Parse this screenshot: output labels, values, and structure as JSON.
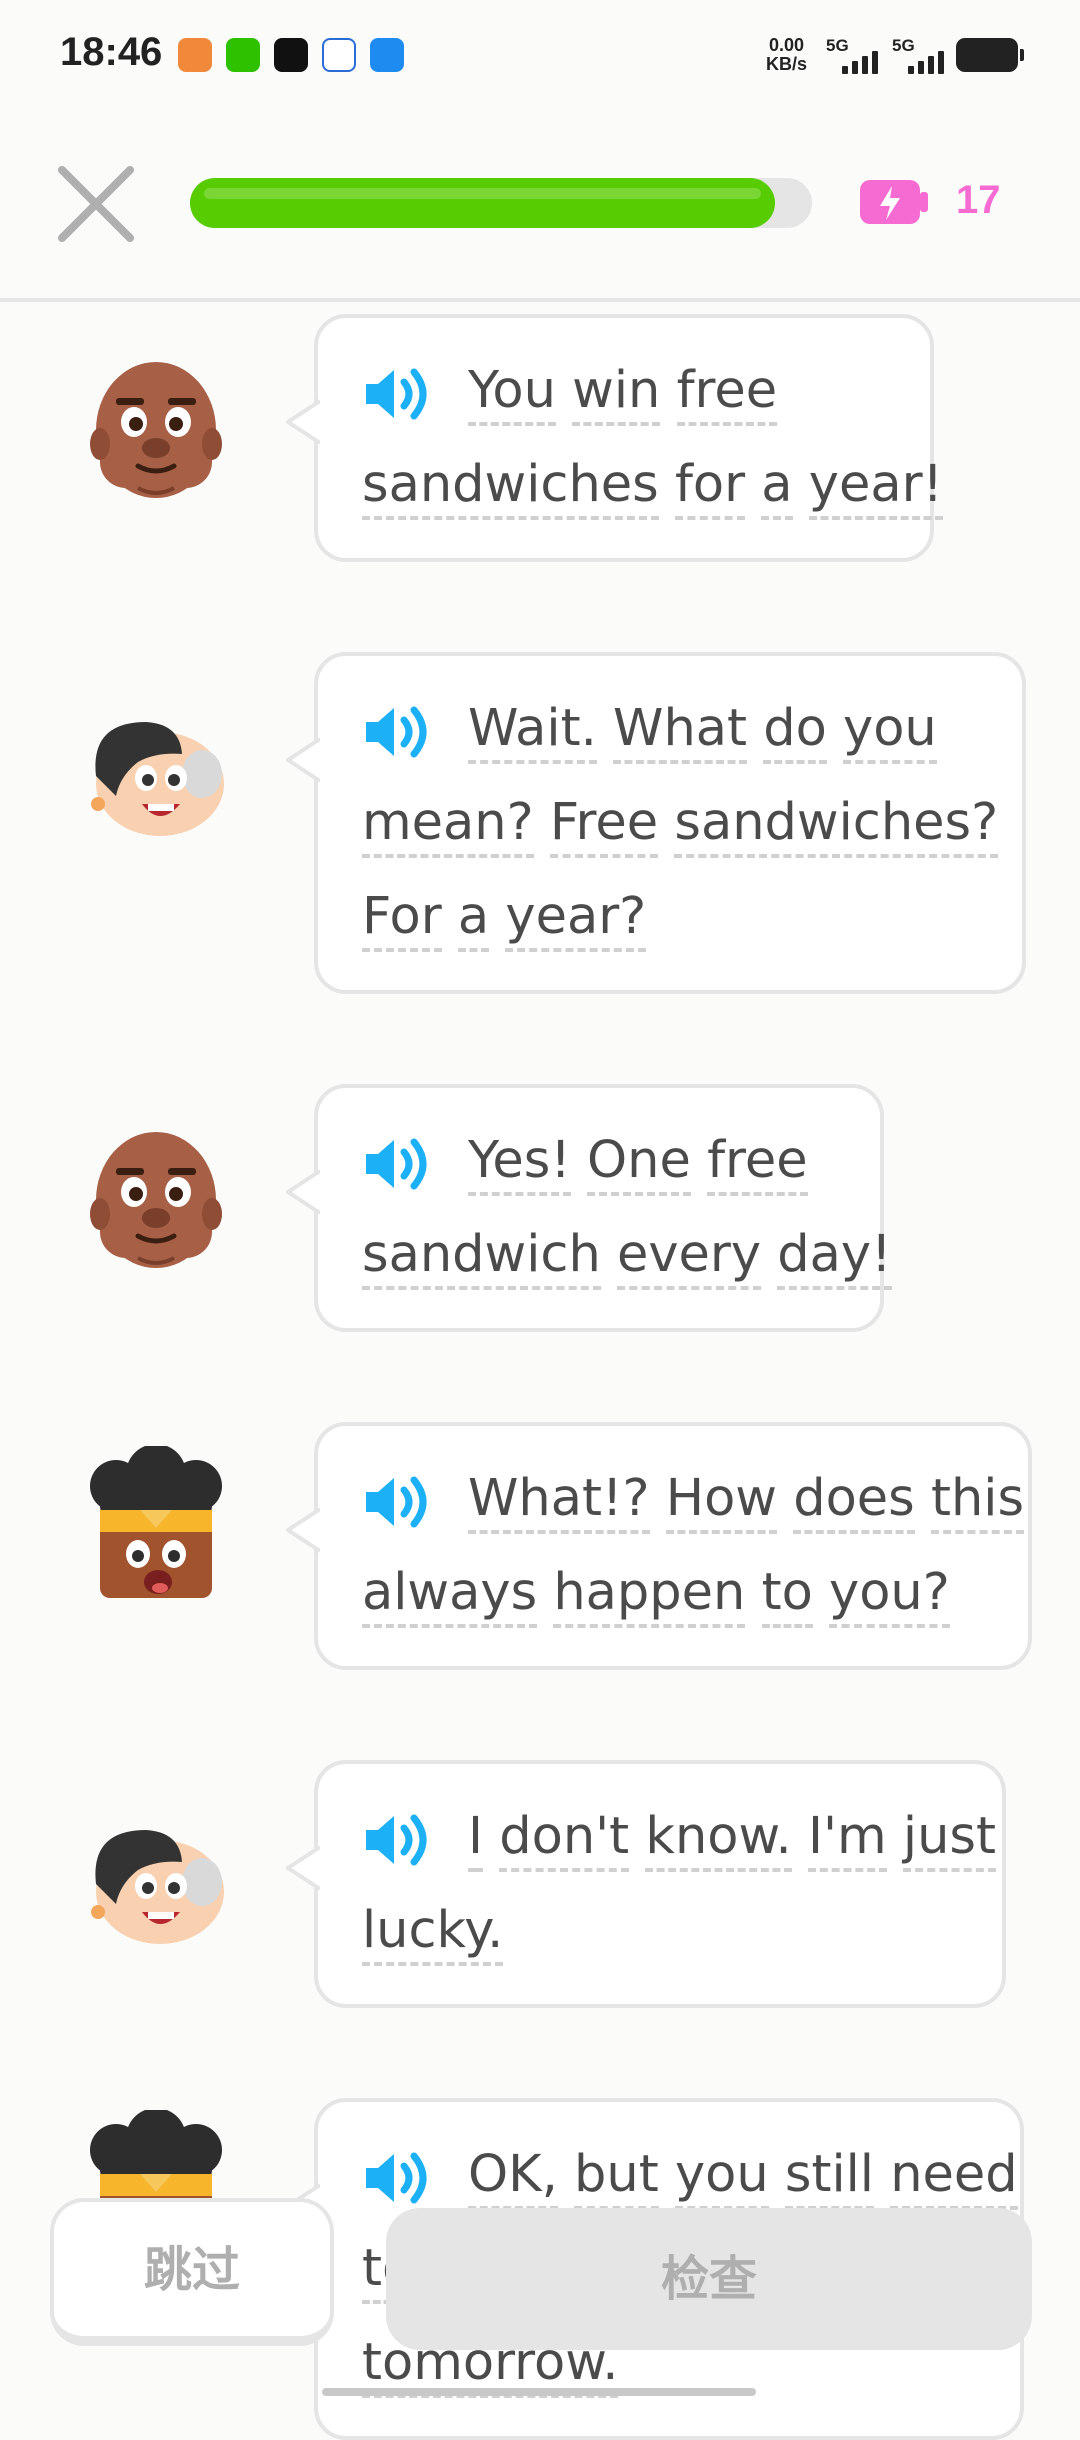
{
  "status_bar": {
    "time": "18:46",
    "net_speed_value": "0.00",
    "net_speed_unit": "KB/s",
    "sim1_label": "5G",
    "sim2_label": "5G"
  },
  "header": {
    "progress_fraction": 0.94,
    "energy_count": "17",
    "accent_green": "#58cc02",
    "energy_color": "#f56bd1"
  },
  "dialogue": [
    {
      "speaker": "eddy",
      "lines": [
        [
          "You",
          "win",
          "free"
        ],
        [
          "sandwiches",
          "for",
          "a",
          "year!"
        ]
      ]
    },
    {
      "speaker": "lin",
      "lines": [
        [
          "Wait.",
          "What",
          "do",
          "you"
        ],
        [
          "mean?",
          "Free",
          "sandwiches?"
        ],
        [
          "For",
          "a",
          "year?"
        ]
      ]
    },
    {
      "speaker": "eddy",
      "lines": [
        [
          "Yes!",
          "One",
          "free"
        ],
        [
          "sandwich",
          "every",
          "day!"
        ]
      ]
    },
    {
      "speaker": "bea",
      "lines": [
        [
          "What!?",
          "How",
          "does",
          "this"
        ],
        [
          "always",
          "happen",
          "to",
          "you?"
        ]
      ]
    },
    {
      "speaker": "lin",
      "lines": [
        [
          "I",
          "don't",
          "know.",
          "I'm",
          "just"
        ],
        [
          "lucky."
        ]
      ]
    },
    {
      "speaker": "bea",
      "lines": [
        [
          "OK,",
          "but",
          "you",
          "still",
          "need"
        ],
        [
          "to"
        ],
        [
          "tomorrow."
        ]
      ]
    }
  ],
  "buttons": {
    "skip_label": "跳过",
    "check_label": "检查"
  }
}
